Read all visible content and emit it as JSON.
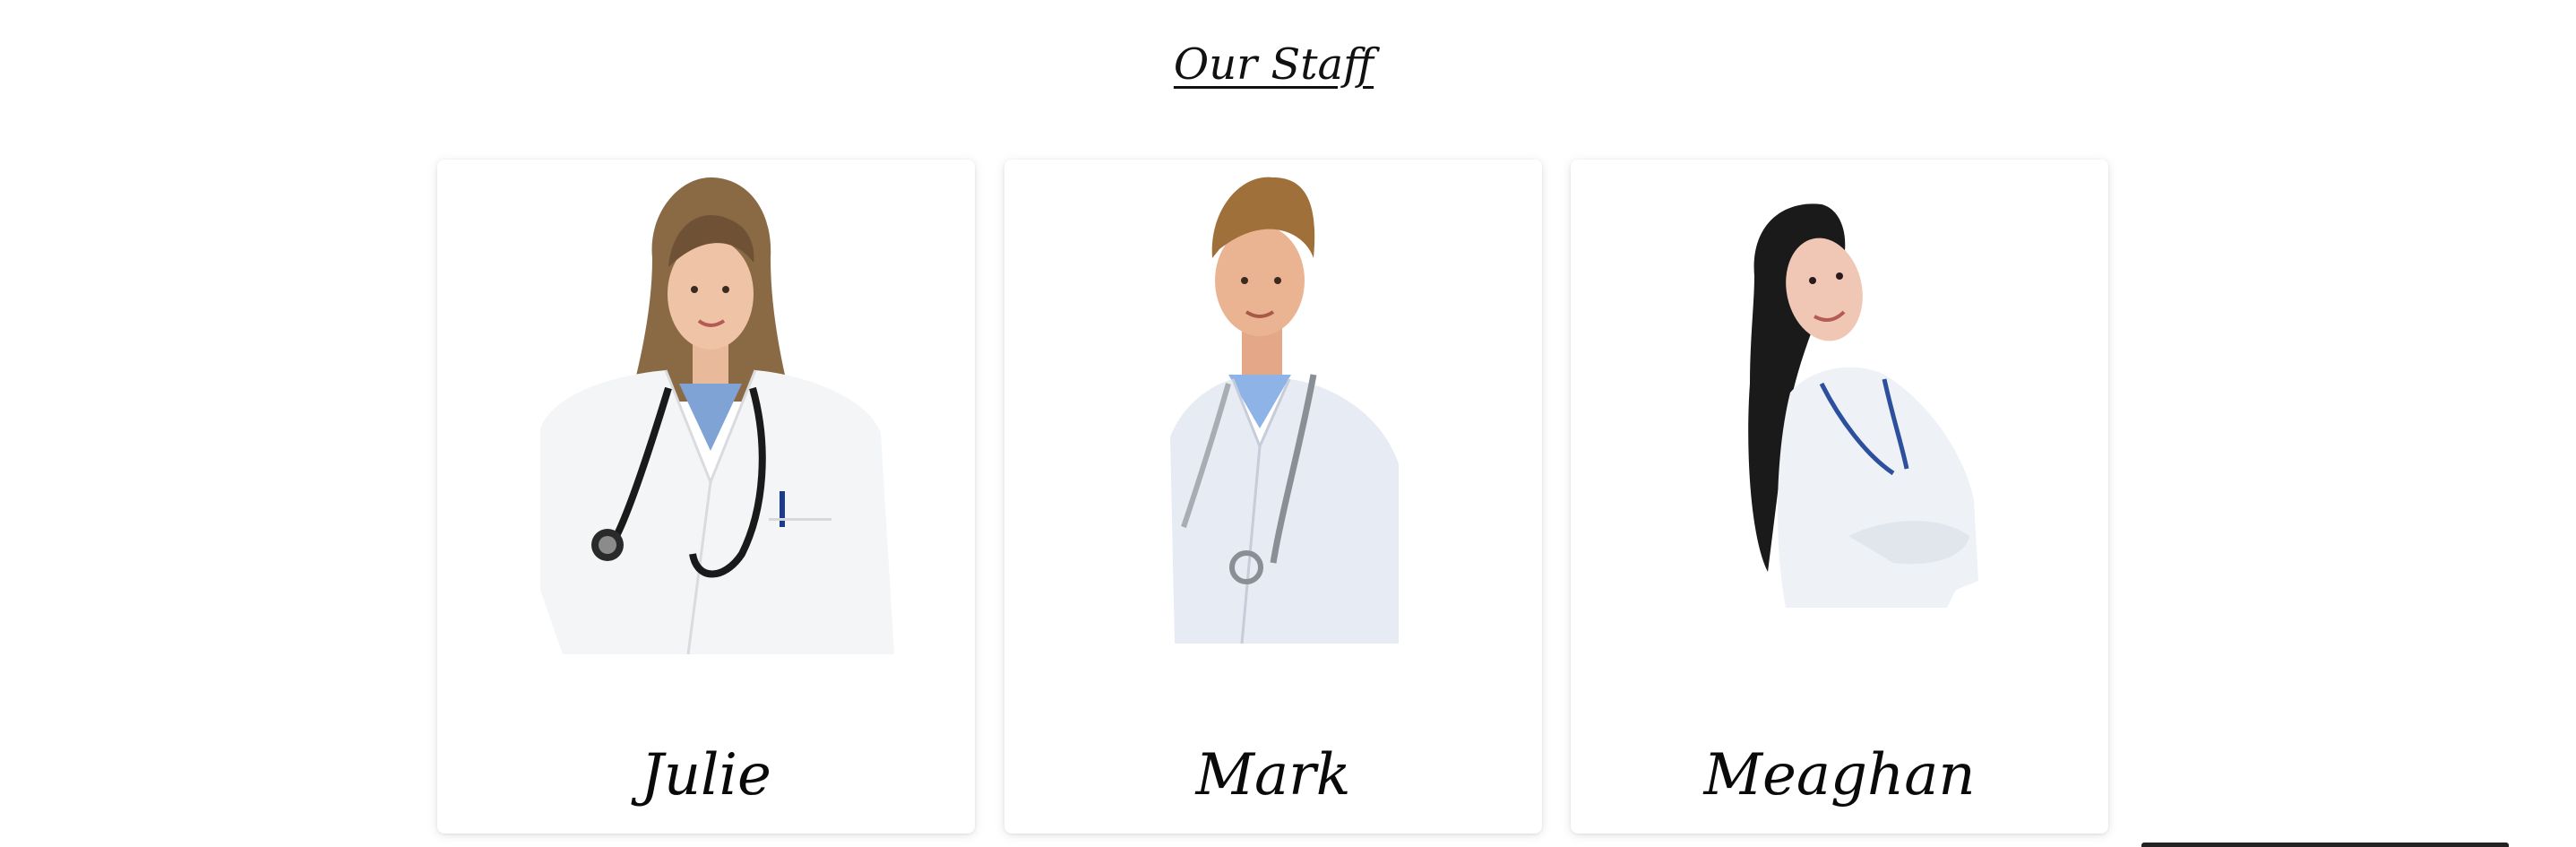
{
  "heading": "Our Staff",
  "staff": [
    {
      "name": "Julie"
    },
    {
      "name": "Mark"
    },
    {
      "name": "Meaghan"
    }
  ],
  "colors": {
    "coat": "#f3f4f6",
    "scrubs": "#6f94cf",
    "text": "#0a0a0a"
  }
}
